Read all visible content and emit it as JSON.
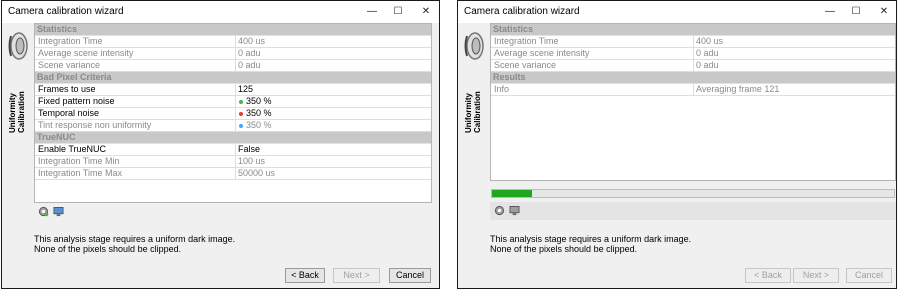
{
  "left": {
    "title": "Camera calibration wizard",
    "sidebar_label": [
      "Uniformity",
      "Calibration"
    ],
    "groups": [
      {
        "label": "Statistics",
        "rows": [
          {
            "key": "Integration Time",
            "value": "400 us",
            "on": false
          },
          {
            "key": "Average scene intensity",
            "value": "0 adu",
            "on": false
          },
          {
            "key": "Scene variance",
            "value": "0 adu",
            "on": false
          }
        ]
      },
      {
        "label": "Bad Pixel Criteria",
        "rows": [
          {
            "key": "Frames to use",
            "value": "125",
            "on": true
          },
          {
            "key": "Fixed pattern noise",
            "value": "350 %",
            "on": true,
            "dot": "#4caf50"
          },
          {
            "key": "Temporal noise",
            "value": "350 %",
            "on": true,
            "dot": "#e53935"
          },
          {
            "key": "Tint response non uniformity",
            "value": "350 %",
            "on": false,
            "dot": "#42a5f5"
          }
        ]
      },
      {
        "label": "TrueNUC",
        "rows": [
          {
            "key": "Enable TrueNUC",
            "value": "False",
            "on": true
          },
          {
            "key": "Integration Time Min",
            "value": "100 us",
            "on": false
          },
          {
            "key": "Integration Time Max",
            "value": "50000 us",
            "on": false
          }
        ]
      }
    ],
    "message": [
      "This analysis stage requires a uniform dark image.",
      "None of the pixels should be clipped."
    ],
    "buttons": {
      "back": "< Back",
      "next": "Next >",
      "cancel": "Cancel"
    }
  },
  "right": {
    "title": "Camera calibration wizard",
    "sidebar_label": [
      "Uniformity",
      "Calibration"
    ],
    "groups": [
      {
        "label": "Statistics",
        "rows": [
          {
            "key": "Integration Time",
            "value": "400 us",
            "on": false
          },
          {
            "key": "Average scene intensity",
            "value": "0 adu",
            "on": false
          },
          {
            "key": "Scene variance",
            "value": "0 adu",
            "on": false
          }
        ]
      },
      {
        "label": "Results",
        "rows": [
          {
            "key": "Info",
            "value": "Averaging frame 121",
            "on": false
          }
        ]
      }
    ],
    "progress": 0.1,
    "message": [
      "This analysis stage requires a uniform dark image.",
      "None of the pixels should be clipped."
    ],
    "buttons": {
      "back": "< Back",
      "next": "Next >",
      "cancel": "Cancel"
    }
  },
  "icons": [
    "camera-lens-icon",
    "settings-gear-icon",
    "monitor-icon",
    "minimize-icon",
    "maximize-icon",
    "close-icon"
  ]
}
